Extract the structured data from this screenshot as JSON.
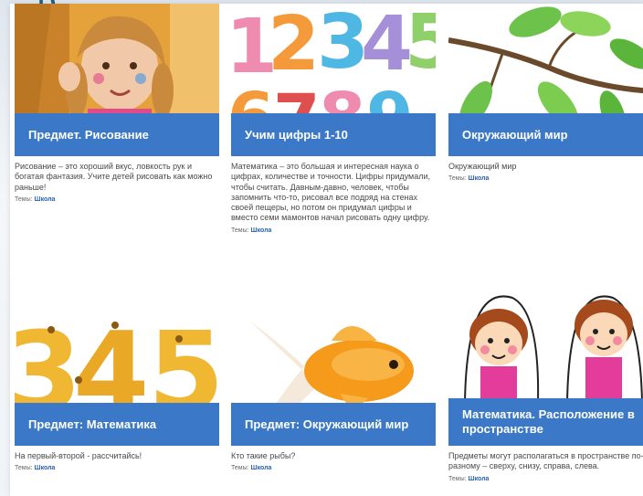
{
  "cards": [
    {
      "title": "Предмет. Рисование",
      "desc": "Рисование – это хороший вкус, ловкость рук и богатая фантазия. Учите детей рисовать как можно раньше!",
      "tags_label": "Темы:",
      "tag": "Школа"
    },
    {
      "title": "Учим цифры 1-10",
      "desc": "Математика – это большая и интересная наука о цифрах, количестве и точности. Цифры придумали, чтобы считать. Давным-давно, человек, чтобы запомнить что-то, рисовал все подряд на стенах своей пещеры, но потом он придумал цифры и вместо семи мамонтов начал рисовать одну цифру.",
      "tags_label": "Темы:",
      "tag": "Школа"
    },
    {
      "title": "Окружающий мир",
      "desc": "Окружающий мир",
      "tags_label": "Темы:",
      "tag": "Школа"
    },
    {
      "title": "Предмет: Математика",
      "desc": "На первый-второй - рассчитайсь!",
      "tags_label": "Темы:",
      "tag": "Школа"
    },
    {
      "title": "Предмет: Окружающий мир",
      "desc": "Кто такие рыбы?",
      "tags_label": "Темы:",
      "tag": "Школа"
    },
    {
      "title": "Математика. Расположение в пространстве",
      "desc": "Предметы могут располагаться в пространстве по-разному – сверху, снизу, справа, слева.",
      "tags_label": "Темы:",
      "tag": "Школа"
    }
  ],
  "colors": {
    "title_bar": "#3b79c8",
    "tag_link": "#2b62b0"
  }
}
